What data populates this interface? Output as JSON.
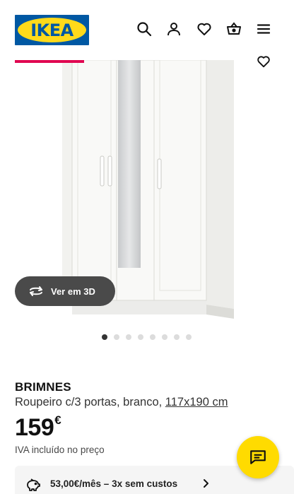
{
  "header": {
    "logo_text": "IKEA",
    "icons": [
      "search-icon",
      "account-icon",
      "heart-icon",
      "basket-icon",
      "menu-icon"
    ]
  },
  "gallery": {
    "view3d_label": "Ver em 3D",
    "dots_total": 8,
    "active_dot": 1
  },
  "product": {
    "name": "BRIMNES",
    "description": "Roupeiro c/3 portas, branco,",
    "dimensions": "117x190 cm",
    "price": "159",
    "currency": "€",
    "vat_note": "IVA incluído no preço"
  },
  "finance": {
    "label": "53,00€/mês – 3x sem custos"
  },
  "colors": {
    "ikea_blue": "#0058a3",
    "ikea_yellow": "#ffda1a",
    "accent_red": "#e00751",
    "chat_yellow": "#ffdb00"
  }
}
